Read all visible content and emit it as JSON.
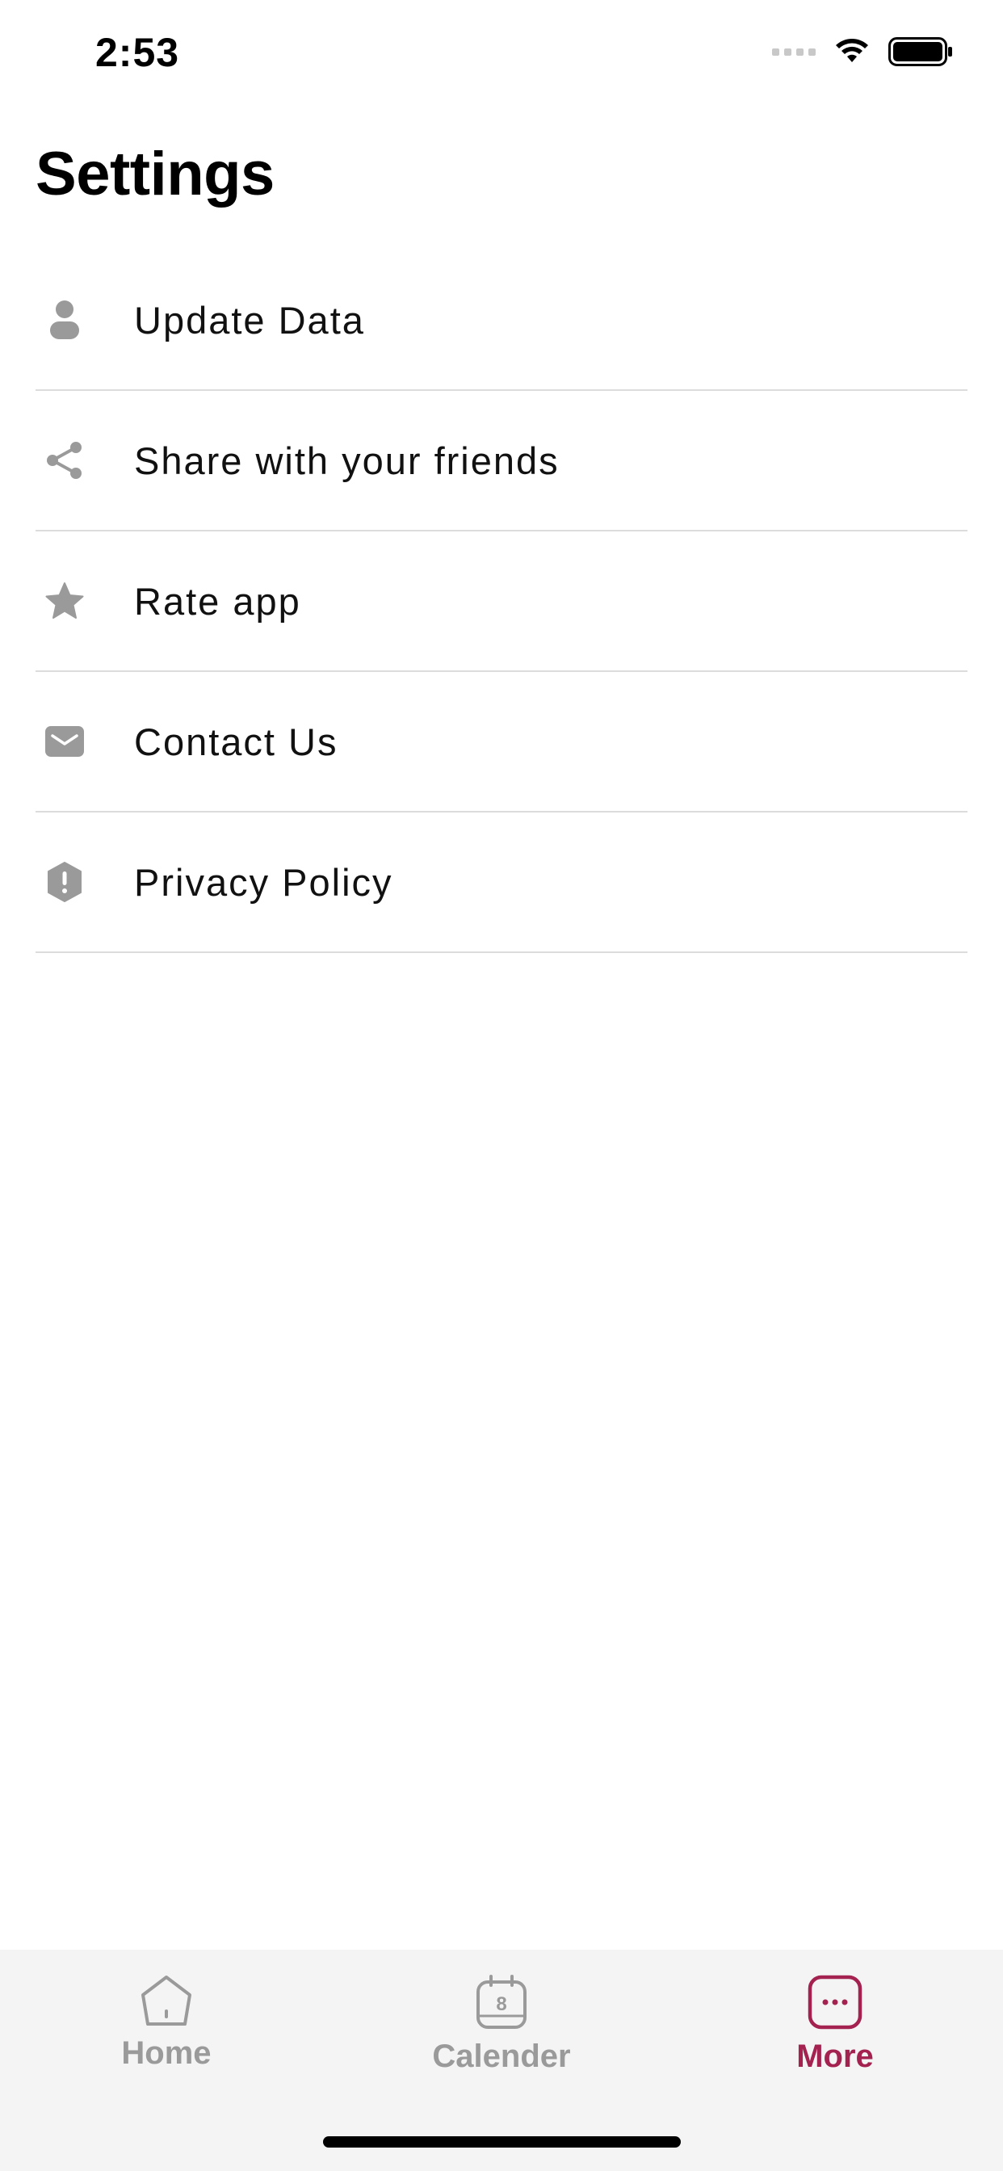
{
  "status_bar": {
    "time": "2:53"
  },
  "page": {
    "title": "Settings"
  },
  "settings": {
    "items": [
      {
        "label": "Update Data",
        "icon": "person-icon"
      },
      {
        "label": "Share with your friends",
        "icon": "share-icon"
      },
      {
        "label": "Rate app",
        "icon": "star-icon"
      },
      {
        "label": "Contact Us",
        "icon": "mail-icon"
      },
      {
        "label": "Privacy Policy",
        "icon": "shield-alert-icon"
      }
    ]
  },
  "bottom_nav": {
    "items": [
      {
        "label": "Home",
        "icon": "home-icon",
        "active": false
      },
      {
        "label": "Calender",
        "icon": "calendar-icon",
        "calendar_day": "8",
        "active": false
      },
      {
        "label": "More",
        "icon": "more-icon",
        "active": true
      }
    ]
  },
  "colors": {
    "accent": "#A3224F",
    "icon_gray": "#9a9a9a",
    "divider": "#dcdcdc"
  }
}
